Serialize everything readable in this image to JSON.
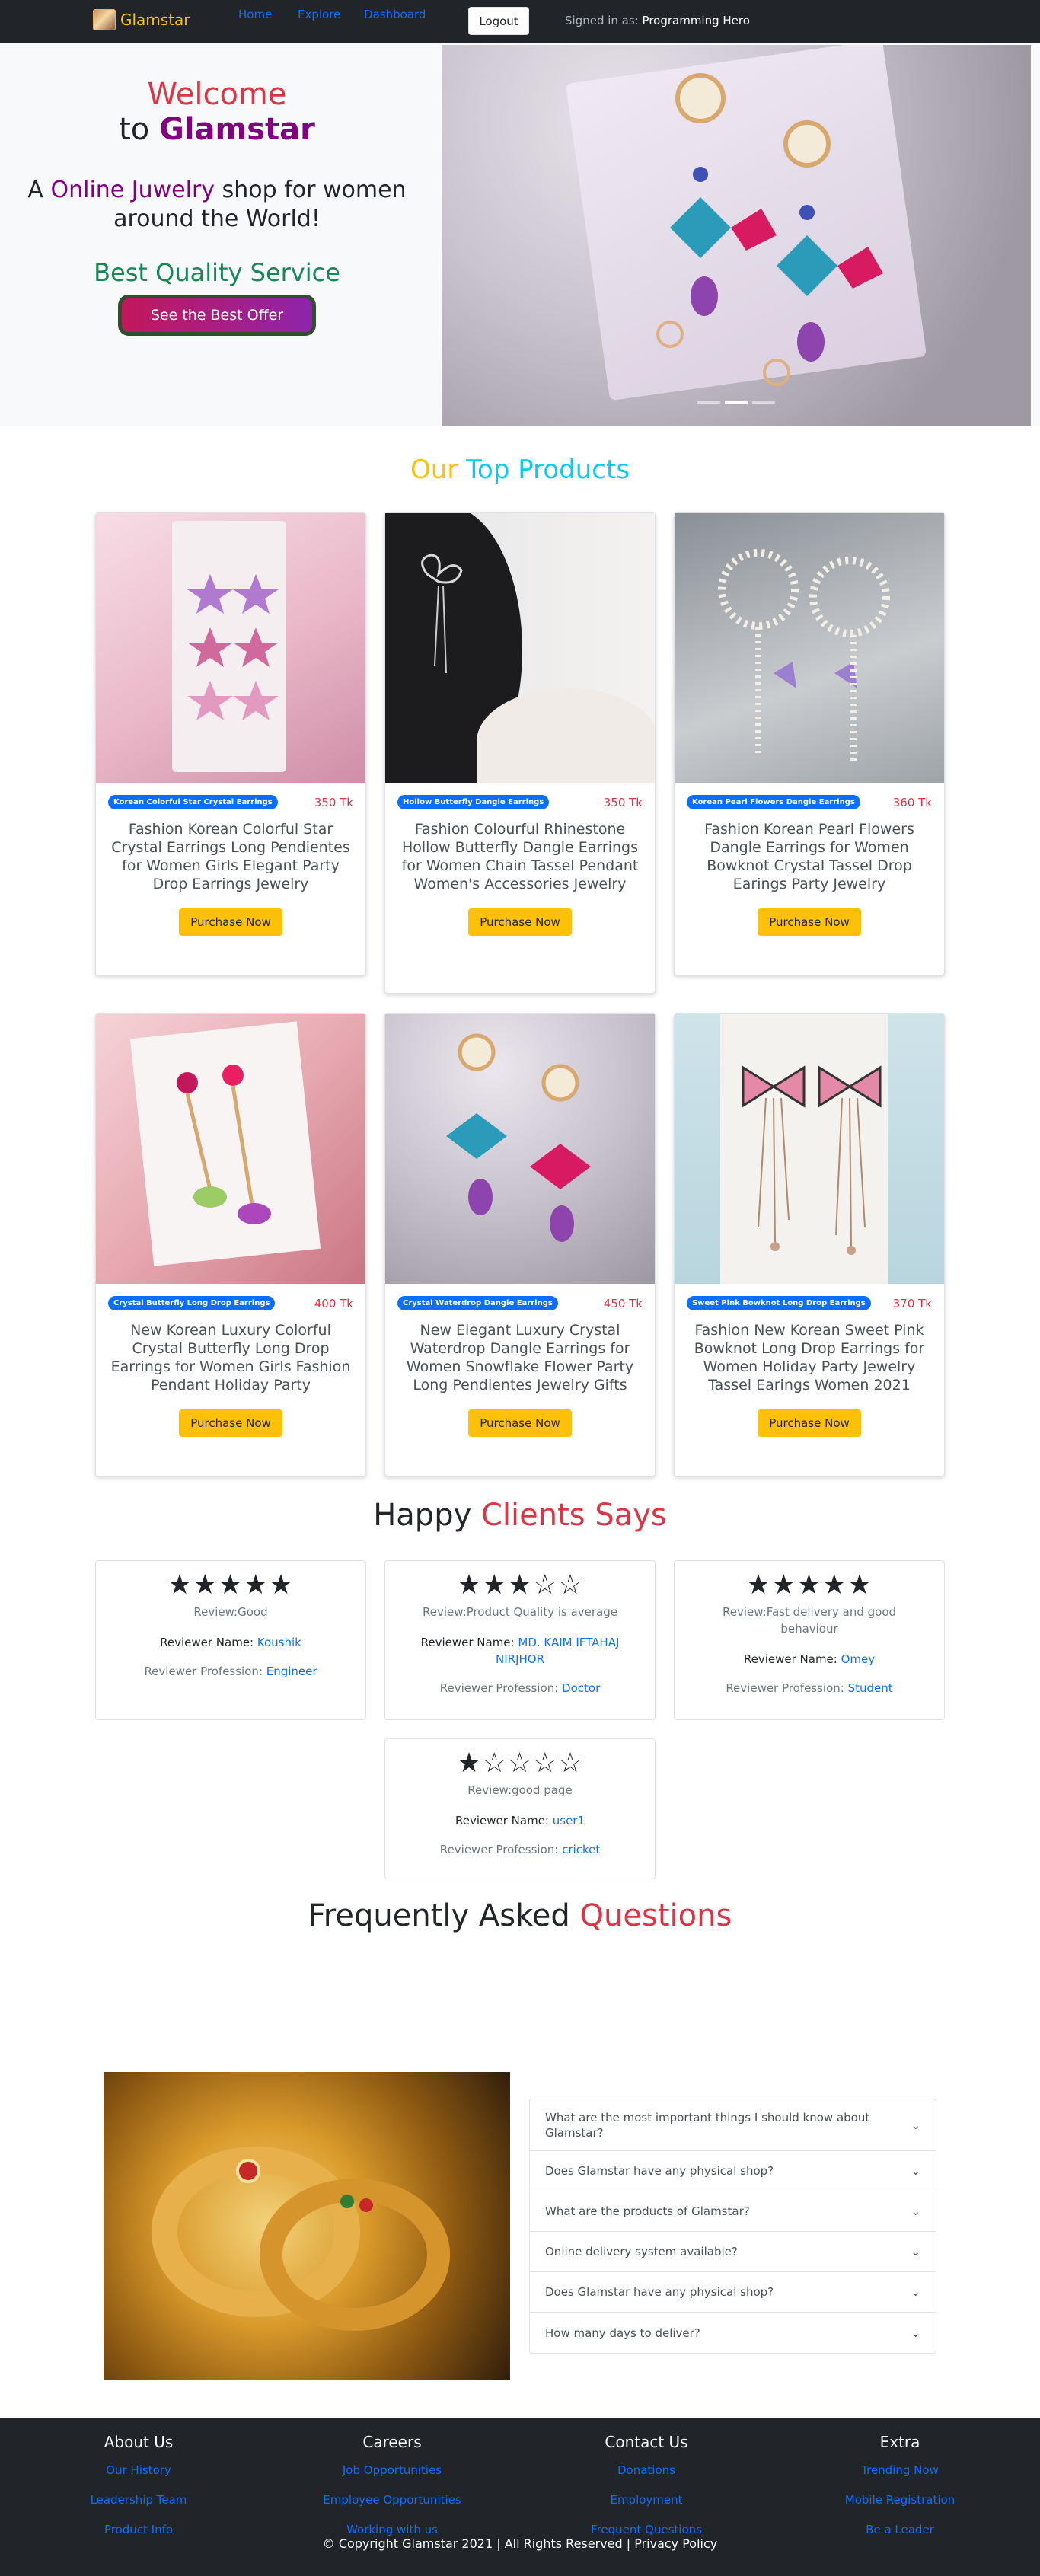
{
  "nav": {
    "brand": "Glamstar",
    "links": [
      "Home",
      "Explore",
      "Dashboard"
    ],
    "logout": "Logout",
    "signed_in_label": "Signed in as:",
    "user": "Programming Hero"
  },
  "hero": {
    "welcome": "Welcome",
    "to": "to",
    "brand": "Glamstar",
    "tagline_a": "A",
    "tagline_highlight": "Online Juwelry",
    "tagline_b": "shop for women around the World!",
    "quality": "Best Quality Service",
    "offer_button": "See the Best Offer"
  },
  "products_section": {
    "title_a": "Our",
    "title_b": "Top Products",
    "buy_label": "Purchase Now",
    "items": [
      {
        "badge": "Korean Colorful Star Crystal Earrings",
        "price": "350 Tk",
        "name": "Fashion Korean Colorful Star Crystal Earrings Long Pendientes for Women Girls Elegant Party Drop Earrings Jewelry"
      },
      {
        "badge": "Hollow Butterfly Dangle Earrings",
        "price": "350 Tk",
        "name": "Fashion Colourful Rhinestone Hollow Butterfly Dangle Earrings for Women Chain Tassel Pendant Women's Accessories Jewelry"
      },
      {
        "badge": "Korean Pearl Flowers Dangle Earrings",
        "price": "360 Tk",
        "name": "Fashion Korean Pearl Flowers Dangle Earrings for Women Bowknot Crystal Tassel Drop Earings Party Jewelry"
      },
      {
        "badge": "Crystal Butterfly Long Drop Earrings",
        "price": "400 Tk",
        "name": "New Korean Luxury Colorful Crystal Butterfly Long Drop Earrings for Women Girls Fashion Pendant Holiday Party"
      },
      {
        "badge": "Crystal Waterdrop Dangle Earrings",
        "price": "450 Tk",
        "name": "New Elegant Luxury Crystal Waterdrop Dangle Earrings for Women Snowflake Flower Party Long Pendientes Jewelry Gifts"
      },
      {
        "badge": "Sweet Pink Bowknot Long Drop Earrings",
        "price": "370 Tk",
        "name": "Fashion New Korean Sweet Pink Bowknot Long Drop Earrings for Women Holiday Party Jewelry Tassel Earings Women 2021"
      }
    ]
  },
  "reviews_section": {
    "title_a": "Happy",
    "title_b": "Clients Says",
    "name_label": "Reviewer Name:",
    "prof_label": "Reviewer Profession:",
    "items": [
      {
        "stars": "★★★★★",
        "review": "Review:Good",
        "name": "Koushik",
        "profession": "Engineer"
      },
      {
        "stars": "★★★☆☆",
        "review": "Review:Product Quality is average",
        "name": "MD. KAIM IFTAHAJ NIRJHOR",
        "profession": "Doctor"
      },
      {
        "stars": "★★★★★",
        "review": "Review:Fast delivery and good behaviour",
        "name": "Omey",
        "profession": "Student"
      },
      {
        "stars": "★☆☆☆☆",
        "review": "Review:good page",
        "name": "user1",
        "profession": "cricket"
      }
    ]
  },
  "faq_section": {
    "title_a": "Frequently Asked",
    "title_b": "Questions",
    "questions": [
      "What are the most important things I should know about Glamstar?",
      "Does Glamstar have any physical shop?",
      "What are the products of Glamstar?",
      "Online delivery system available?",
      "Does Glamstar have any physical shop?",
      "How many days to deliver?"
    ]
  },
  "footer": {
    "columns": [
      {
        "title": "About Us",
        "links": [
          "Our History",
          "Leadership Team",
          "Product Info"
        ]
      },
      {
        "title": "Careers",
        "links": [
          "Job Opportunities",
          "Employee Opportunities",
          "Working with us"
        ]
      },
      {
        "title": "Contact Us",
        "links": [
          "Donations",
          "Employment",
          "Frequent Questions"
        ]
      },
      {
        "title": "Extra",
        "links": [
          "Trending Now",
          "Mobile Registration",
          "Be a Leader"
        ]
      }
    ],
    "copyright": "© Copyright Glamstar 2021 | All Rights Reserved | Privacy Policy"
  }
}
